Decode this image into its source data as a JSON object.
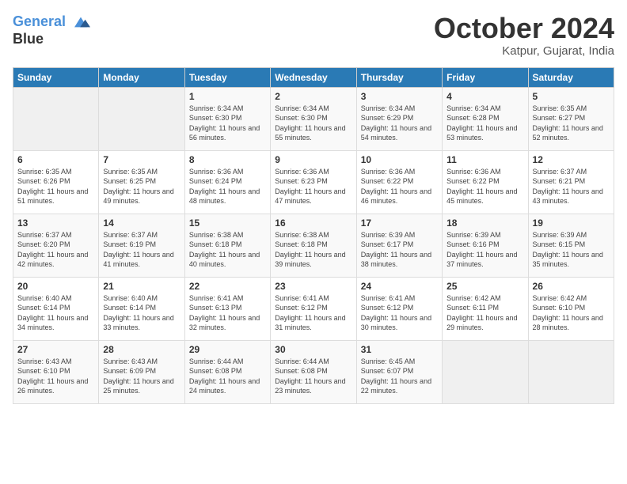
{
  "logo": {
    "line1": "General",
    "line2": "Blue"
  },
  "title": "October 2024",
  "location": "Katpur, Gujarat, India",
  "days_of_week": [
    "Sunday",
    "Monday",
    "Tuesday",
    "Wednesday",
    "Thursday",
    "Friday",
    "Saturday"
  ],
  "weeks": [
    [
      {
        "day": "",
        "empty": true
      },
      {
        "day": "",
        "empty": true
      },
      {
        "day": "1",
        "sunrise": "6:34 AM",
        "sunset": "6:30 PM",
        "daylight": "11 hours and 56 minutes."
      },
      {
        "day": "2",
        "sunrise": "6:34 AM",
        "sunset": "6:30 PM",
        "daylight": "11 hours and 55 minutes."
      },
      {
        "day": "3",
        "sunrise": "6:34 AM",
        "sunset": "6:29 PM",
        "daylight": "11 hours and 54 minutes."
      },
      {
        "day": "4",
        "sunrise": "6:34 AM",
        "sunset": "6:28 PM",
        "daylight": "11 hours and 53 minutes."
      },
      {
        "day": "5",
        "sunrise": "6:35 AM",
        "sunset": "6:27 PM",
        "daylight": "11 hours and 52 minutes."
      }
    ],
    [
      {
        "day": "6",
        "sunrise": "6:35 AM",
        "sunset": "6:26 PM",
        "daylight": "11 hours and 51 minutes."
      },
      {
        "day": "7",
        "sunrise": "6:35 AM",
        "sunset": "6:25 PM",
        "daylight": "11 hours and 49 minutes."
      },
      {
        "day": "8",
        "sunrise": "6:36 AM",
        "sunset": "6:24 PM",
        "daylight": "11 hours and 48 minutes."
      },
      {
        "day": "9",
        "sunrise": "6:36 AM",
        "sunset": "6:23 PM",
        "daylight": "11 hours and 47 minutes."
      },
      {
        "day": "10",
        "sunrise": "6:36 AM",
        "sunset": "6:22 PM",
        "daylight": "11 hours and 46 minutes."
      },
      {
        "day": "11",
        "sunrise": "6:36 AM",
        "sunset": "6:22 PM",
        "daylight": "11 hours and 45 minutes."
      },
      {
        "day": "12",
        "sunrise": "6:37 AM",
        "sunset": "6:21 PM",
        "daylight": "11 hours and 43 minutes."
      }
    ],
    [
      {
        "day": "13",
        "sunrise": "6:37 AM",
        "sunset": "6:20 PM",
        "daylight": "11 hours and 42 minutes."
      },
      {
        "day": "14",
        "sunrise": "6:37 AM",
        "sunset": "6:19 PM",
        "daylight": "11 hours and 41 minutes."
      },
      {
        "day": "15",
        "sunrise": "6:38 AM",
        "sunset": "6:18 PM",
        "daylight": "11 hours and 40 minutes."
      },
      {
        "day": "16",
        "sunrise": "6:38 AM",
        "sunset": "6:18 PM",
        "daylight": "11 hours and 39 minutes."
      },
      {
        "day": "17",
        "sunrise": "6:39 AM",
        "sunset": "6:17 PM",
        "daylight": "11 hours and 38 minutes."
      },
      {
        "day": "18",
        "sunrise": "6:39 AM",
        "sunset": "6:16 PM",
        "daylight": "11 hours and 37 minutes."
      },
      {
        "day": "19",
        "sunrise": "6:39 AM",
        "sunset": "6:15 PM",
        "daylight": "11 hours and 35 minutes."
      }
    ],
    [
      {
        "day": "20",
        "sunrise": "6:40 AM",
        "sunset": "6:14 PM",
        "daylight": "11 hours and 34 minutes."
      },
      {
        "day": "21",
        "sunrise": "6:40 AM",
        "sunset": "6:14 PM",
        "daylight": "11 hours and 33 minutes."
      },
      {
        "day": "22",
        "sunrise": "6:41 AM",
        "sunset": "6:13 PM",
        "daylight": "11 hours and 32 minutes."
      },
      {
        "day": "23",
        "sunrise": "6:41 AM",
        "sunset": "6:12 PM",
        "daylight": "11 hours and 31 minutes."
      },
      {
        "day": "24",
        "sunrise": "6:41 AM",
        "sunset": "6:12 PM",
        "daylight": "11 hours and 30 minutes."
      },
      {
        "day": "25",
        "sunrise": "6:42 AM",
        "sunset": "6:11 PM",
        "daylight": "11 hours and 29 minutes."
      },
      {
        "day": "26",
        "sunrise": "6:42 AM",
        "sunset": "6:10 PM",
        "daylight": "11 hours and 28 minutes."
      }
    ],
    [
      {
        "day": "27",
        "sunrise": "6:43 AM",
        "sunset": "6:10 PM",
        "daylight": "11 hours and 26 minutes."
      },
      {
        "day": "28",
        "sunrise": "6:43 AM",
        "sunset": "6:09 PM",
        "daylight": "11 hours and 25 minutes."
      },
      {
        "day": "29",
        "sunrise": "6:44 AM",
        "sunset": "6:08 PM",
        "daylight": "11 hours and 24 minutes."
      },
      {
        "day": "30",
        "sunrise": "6:44 AM",
        "sunset": "6:08 PM",
        "daylight": "11 hours and 23 minutes."
      },
      {
        "day": "31",
        "sunrise": "6:45 AM",
        "sunset": "6:07 PM",
        "daylight": "11 hours and 22 minutes."
      },
      {
        "day": "",
        "empty": true
      },
      {
        "day": "",
        "empty": true
      }
    ]
  ],
  "labels": {
    "sunrise": "Sunrise:",
    "sunset": "Sunset:",
    "daylight": "Daylight:"
  }
}
